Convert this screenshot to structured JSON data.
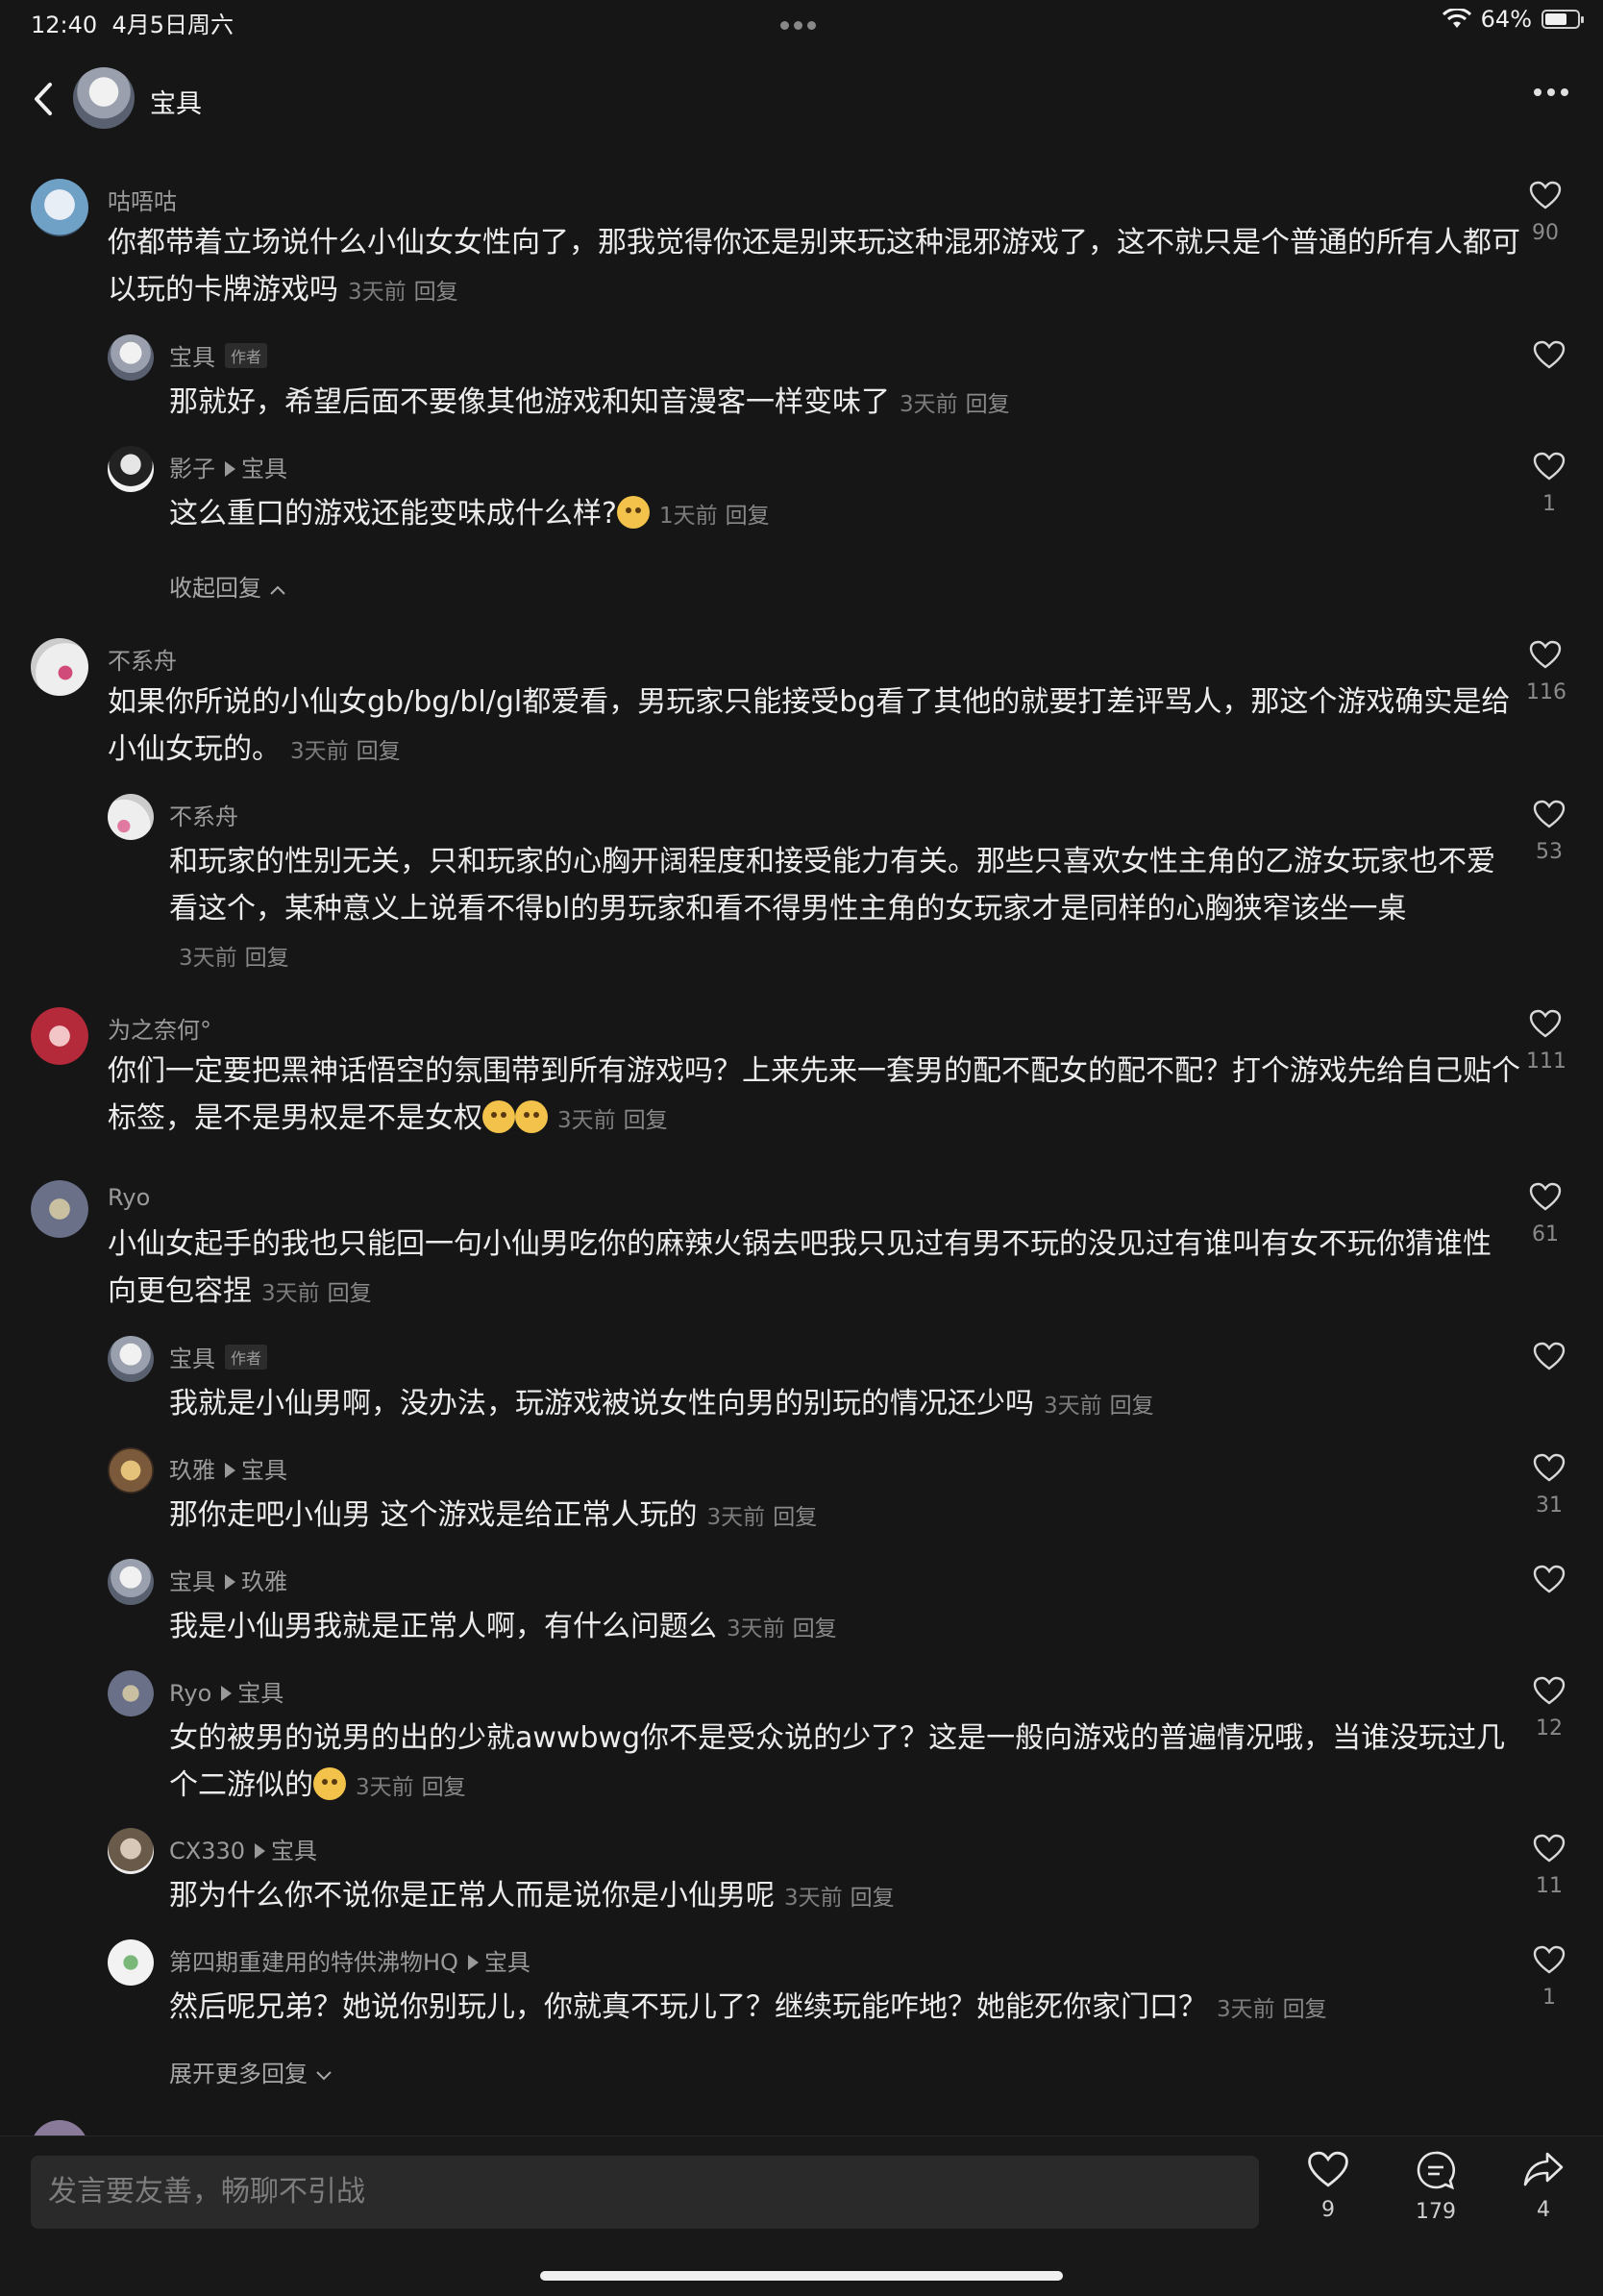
{
  "status": {
    "time": "12:40",
    "date": "4月5日周六",
    "battery": "64%"
  },
  "header": {
    "title": "宝具"
  },
  "comments": [
    {
      "user": "咕唔咕",
      "text": "你都带着立场说什么小仙女女性向了，那我觉得你还是别来玩这种混邪游戏了，这不就只是个普通的所有人都可以玩的卡牌游戏吗",
      "time": "3天前",
      "reply": "回复",
      "likes": "90"
    },
    {
      "user": "宝具",
      "tag": "作者",
      "text": "那就好，希望后面不要像其他游戏和知音漫客一样变味了",
      "time": "3天前",
      "reply": "回复",
      "likes": ""
    },
    {
      "user": "影子",
      "to": "宝具",
      "text": "这么重口的游戏还能变味成什么样?",
      "time": "1天前",
      "reply": "回复",
      "likes": "1"
    },
    {
      "toggle": "收起回复"
    },
    {
      "user": "不系舟",
      "text": "如果你所说的小仙女gb/bg/bl/gl都爱看，男玩家只能接受bg看了其他的就要打差评骂人，那这个游戏确实是给小仙女玩的。",
      "time": "3天前",
      "reply": "回复",
      "likes": "116"
    },
    {
      "user": "不系舟",
      "text": "和玩家的性别无关，只和玩家的心胸开阔程度和接受能力有关。那些只喜欢女性主角的乙游女玩家也不爱看这个，某种意义上说看不得bl的男玩家和看不得男性主角的女玩家才是同样的心胸狭窄该坐一桌",
      "time": "3天前",
      "reply": "回复",
      "likes": "53"
    },
    {
      "user": "为之奈何°",
      "text": "你们一定要把黑神话悟空的氛围带到所有游戏吗？上来先来一套男的配不配女的配不配？打个游戏先给自己贴个标签，是不是男权是不是女权",
      "time": "3天前",
      "reply": "回复",
      "likes": "111"
    },
    {
      "user": "Ryo",
      "text": "小仙女起手的我也只能回一句小仙男吃你的麻辣火锅去吧我只见过有男不玩的没见过有谁叫有女不玩你猜谁性向更包容捏",
      "time": "3天前",
      "reply": "回复",
      "likes": "61"
    },
    {
      "user": "宝具",
      "tag": "作者",
      "text": "我就是小仙男啊，没办法，玩游戏被说女性向男的别玩的情况还少吗",
      "time": "3天前",
      "reply": "回复",
      "likes": ""
    },
    {
      "user": "玖雅",
      "to": "宝具",
      "text": "那你走吧小仙男 这个游戏是给正常人玩的",
      "time": "3天前",
      "reply": "回复",
      "likes": "31"
    },
    {
      "user": "宝具",
      "to": "玖雅",
      "text": "我是小仙男我就是正常人啊，有什么问题么",
      "time": "3天前",
      "reply": "回复",
      "likes": ""
    },
    {
      "user": "Ryo",
      "to": "宝具",
      "text": "女的被男的说男的出的少就awwbwg你不是受众说的少了？这是一般向游戏的普遍情况哦，当谁没玩过几个二游似的",
      "time": "3天前",
      "reply": "回复",
      "likes": "12"
    },
    {
      "user": "CX330",
      "to": "宝具",
      "text": "那为什么你不说你是正常人而是说你是小仙男呢",
      "time": "3天前",
      "reply": "回复",
      "likes": "11"
    },
    {
      "user": "第四期重建用的特供沸物HQ",
      "to": "宝具",
      "text": "然后呢兄弟？她说你别玩儿，你就真不玩儿了？继续玩能咋地？她能死你家门口？",
      "time": "3天前",
      "reply": "回复",
      "likes": "1"
    },
    {
      "toggle": "展开更多回复"
    }
  ],
  "bottom": {
    "placeholder": "发言要友善，畅聊不引战",
    "likes": "9",
    "comments": "179",
    "shares": "4"
  },
  "colors": {
    "background": "#161616",
    "text": "#ececec",
    "muted": "#7c7c7c"
  }
}
